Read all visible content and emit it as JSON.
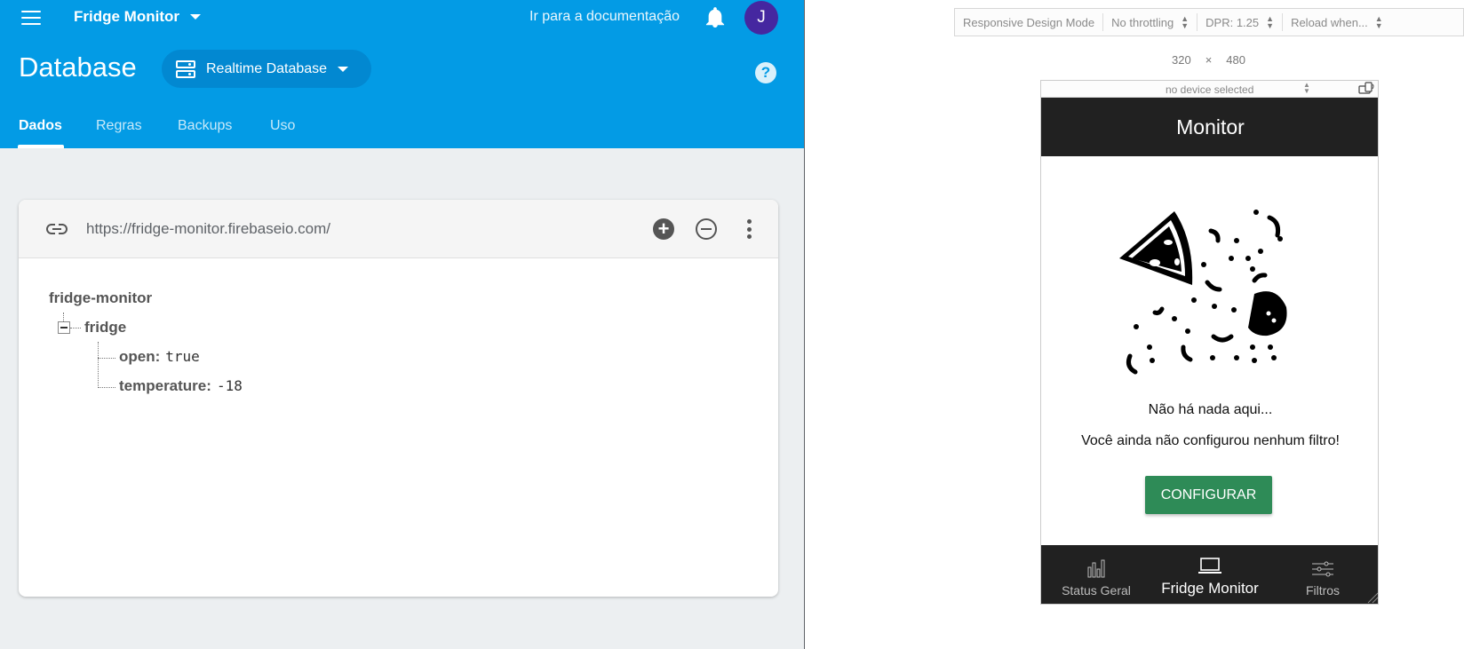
{
  "firebase": {
    "project": "Fridge Monitor",
    "docs_link": "Ir para a documentação",
    "avatar_initial": "J",
    "page_title": "Database",
    "db_selector": "Realtime Database",
    "help": "?",
    "tabs": [
      "Dados",
      "Regras",
      "Backups",
      "Uso"
    ],
    "active_tab": "Dados",
    "db_url": "https://fridge-monitor.firebaseio.com/",
    "tree": {
      "root": "fridge-monitor",
      "child": "fridge",
      "fields": [
        {
          "key": "open",
          "value": "true"
        },
        {
          "key": "temperature",
          "value": "-18"
        }
      ]
    },
    "colors": {
      "header": "#039be5",
      "selector": "#0288d1",
      "avatar": "#4527a0"
    }
  },
  "rdm": {
    "mode": "Responsive Design Mode",
    "throttling": "No throttling",
    "dpr": "DPR: 1.25",
    "reload": "Reload when...",
    "width": "320",
    "times": "×",
    "height": "480",
    "device": "no device selected"
  },
  "app": {
    "title": "Monitor",
    "empty_title": "Não há nada aqui...",
    "empty_message": "Você ainda não configurou nenhum filtro!",
    "configure_button": "CONFIGURAR",
    "nav": [
      {
        "label": "Status Geral",
        "icon": "bar-chart-icon"
      },
      {
        "label": "Fridge Monitor",
        "icon": "laptop-icon"
      },
      {
        "label": "Filtros",
        "icon": "sliders-icon"
      }
    ],
    "active_nav": "Fridge Monitor",
    "colors": {
      "app_bar": "#212121",
      "button": "#2e8b57"
    }
  }
}
